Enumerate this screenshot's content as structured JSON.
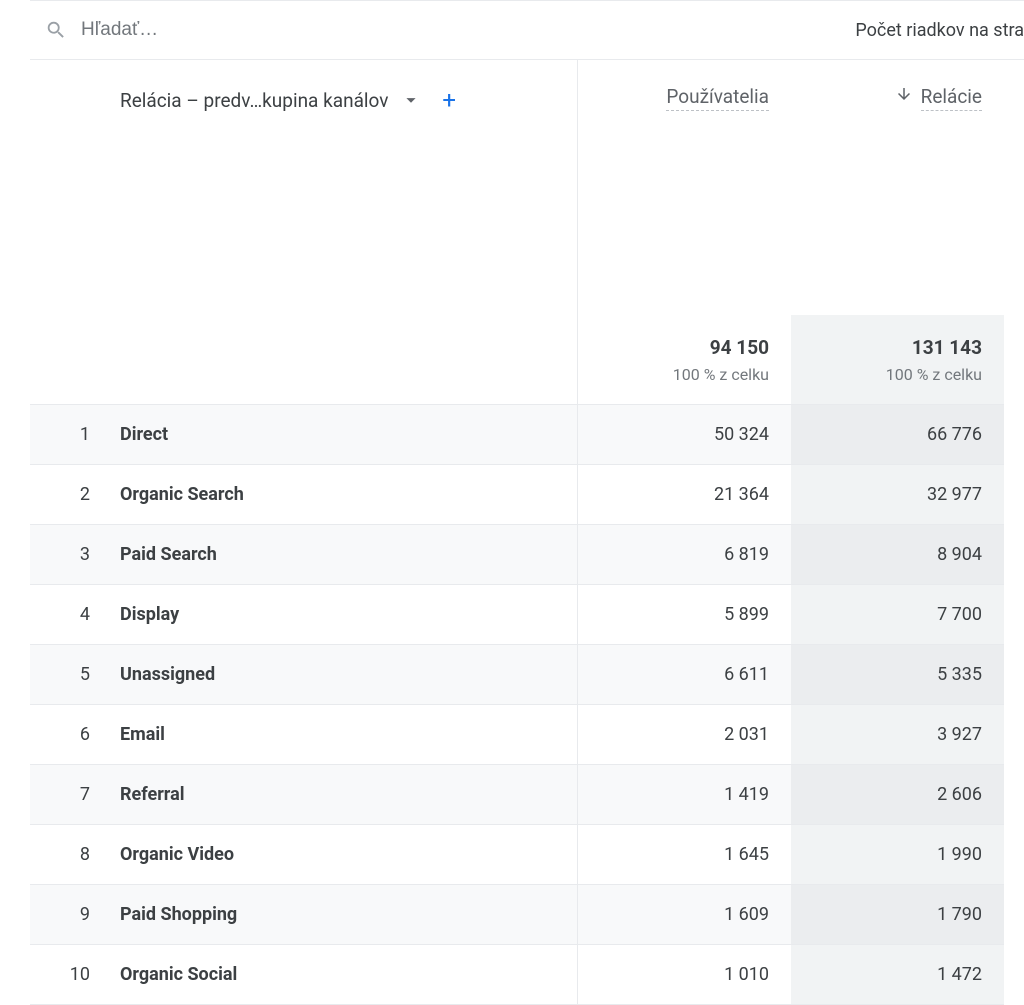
{
  "search": {
    "placeholder": "Hľadať…"
  },
  "rows_label": "Počet riadkov na stra",
  "dimension": {
    "selector_label": "Relácia – predv…kupina kanálov"
  },
  "metrics": [
    {
      "label": "Používatelia",
      "total": "94 150",
      "pct": "100 % z celku",
      "sorted": false
    },
    {
      "label": "Relácie",
      "total": "131 143",
      "pct": "100 % z celku",
      "sorted": true
    }
  ],
  "rows": [
    {
      "index": "1",
      "label": "Direct",
      "values": [
        "50 324",
        "66 776"
      ]
    },
    {
      "index": "2",
      "label": "Organic Search",
      "values": [
        "21 364",
        "32 977"
      ]
    },
    {
      "index": "3",
      "label": "Paid Search",
      "values": [
        "6 819",
        "8 904"
      ]
    },
    {
      "index": "4",
      "label": "Display",
      "values": [
        "5 899",
        "7 700"
      ]
    },
    {
      "index": "5",
      "label": "Unassigned",
      "values": [
        "6 611",
        "5 335"
      ]
    },
    {
      "index": "6",
      "label": "Email",
      "values": [
        "2 031",
        "3 927"
      ]
    },
    {
      "index": "7",
      "label": "Referral",
      "values": [
        "1 419",
        "2 606"
      ]
    },
    {
      "index": "8",
      "label": "Organic Video",
      "values": [
        "1 645",
        "1 990"
      ]
    },
    {
      "index": "9",
      "label": "Paid Shopping",
      "values": [
        "1 609",
        "1 790"
      ]
    },
    {
      "index": "10",
      "label": "Organic Social",
      "values": [
        "1 010",
        "1 472"
      ]
    }
  ]
}
